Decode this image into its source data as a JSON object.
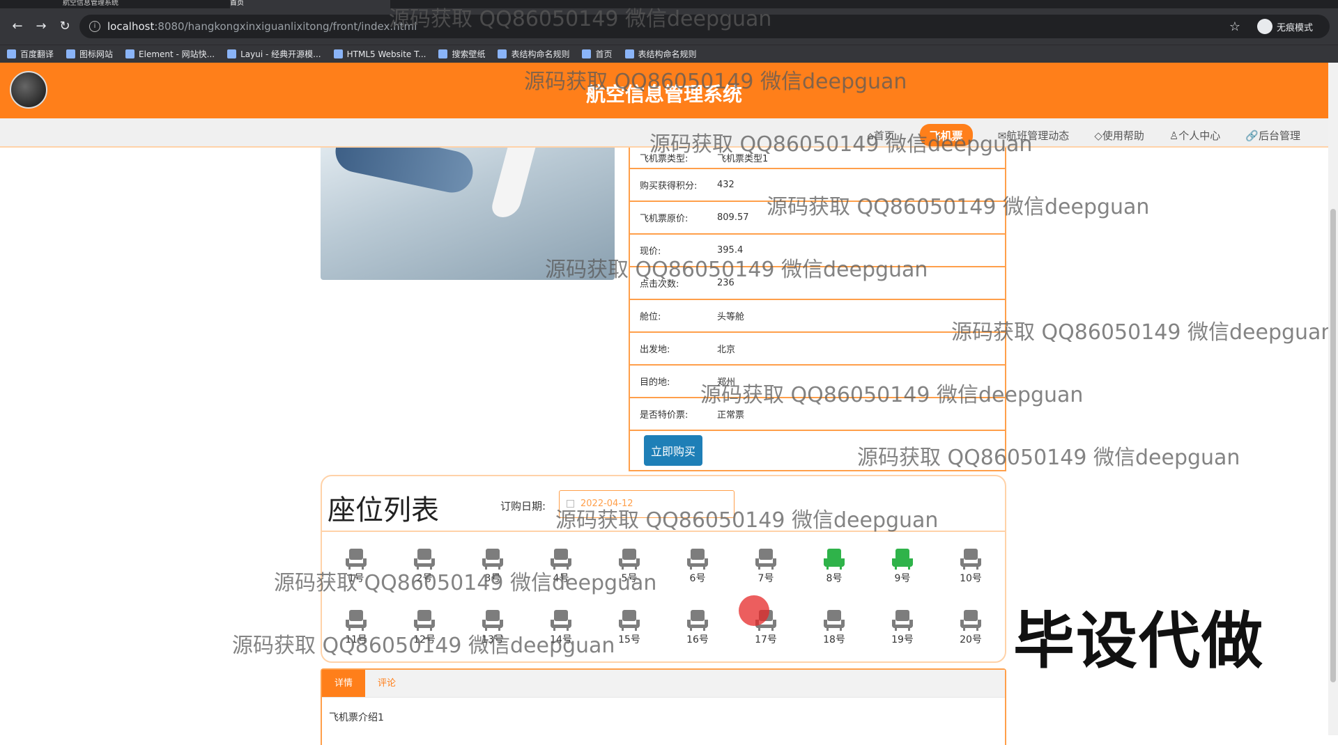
{
  "browser": {
    "tabs": [
      {
        "label": "航空信息管理系统"
      },
      {
        "label": "首页"
      }
    ],
    "url_host": "localhost",
    "url_path": ":8080/hangkongxinxiguanlixitong/front/index.html",
    "incognito_label": "无痕模式",
    "bookmarks": [
      "百度翻译",
      "图标网站",
      "Element - 网站快...",
      "Layui - 经典开源模...",
      "HTML5 Website T...",
      "搜索壁纸",
      "表结构命名规则",
      "首页",
      "表结构命名规则"
    ]
  },
  "site": {
    "title": "航空信息管理系统",
    "nav": [
      {
        "label": "⌂首页"
      },
      {
        "label": "飞机票"
      },
      {
        "label": "✉航班管理动态"
      },
      {
        "label": "◇使用帮助"
      },
      {
        "label": "♙个人中心"
      },
      {
        "label": "🔗后台管理"
      }
    ]
  },
  "detail": {
    "rows": [
      {
        "k": "飞机票类型:",
        "v": "飞机票类型1"
      },
      {
        "k": "购买获得积分:",
        "v": "432"
      },
      {
        "k": "飞机票原价:",
        "v": "809.57"
      },
      {
        "k": "现价:",
        "v": "395.4"
      },
      {
        "k": "点击次数:",
        "v": "236"
      },
      {
        "k": "舱位:",
        "v": "头等舱"
      },
      {
        "k": "出发地:",
        "v": "北京"
      },
      {
        "k": "目的地:",
        "v": "郑州"
      },
      {
        "k": "是否特价票:",
        "v": "正常票"
      }
    ],
    "buy_label": "立即购买"
  },
  "seats": {
    "title": "座位列表",
    "date_label": "订购日期:",
    "date_value": "2022-04-12",
    "list": [
      {
        "label": "1号",
        "sold": false
      },
      {
        "label": "2号",
        "sold": false
      },
      {
        "label": "3号",
        "sold": false
      },
      {
        "label": "4号",
        "sold": false
      },
      {
        "label": "5号",
        "sold": false
      },
      {
        "label": "6号",
        "sold": false
      },
      {
        "label": "7号",
        "sold": false
      },
      {
        "label": "8号",
        "sold": true
      },
      {
        "label": "9号",
        "sold": true
      },
      {
        "label": "10号",
        "sold": false
      },
      {
        "label": "11号",
        "sold": false
      },
      {
        "label": "12号",
        "sold": false
      },
      {
        "label": "13号",
        "sold": false
      },
      {
        "label": "14号",
        "sold": false
      },
      {
        "label": "15号",
        "sold": false
      },
      {
        "label": "16号",
        "sold": false
      },
      {
        "label": "17号",
        "sold": false
      },
      {
        "label": "18号",
        "sold": false
      },
      {
        "label": "19号",
        "sold": false
      },
      {
        "label": "20号",
        "sold": false
      }
    ]
  },
  "tabs": {
    "items": [
      {
        "label": "详情"
      },
      {
        "label": "评论"
      }
    ],
    "content": "飞机票介绍1"
  },
  "overlay": {
    "big_text": "毕设代做",
    "watermark": "源码获取 QQ86050149 微信deepguan"
  },
  "colors": {
    "brand": "#ff7f1a",
    "buy_button": "#1e7fb7",
    "seat_sold": "#2fb34a",
    "seat_free": "#7d7d7d"
  }
}
